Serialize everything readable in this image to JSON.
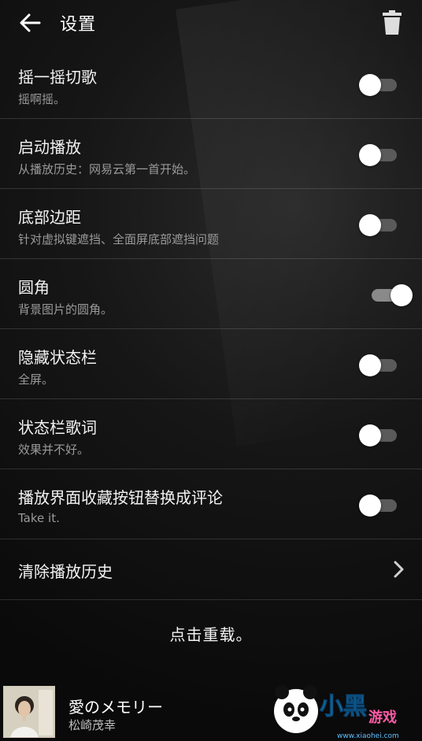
{
  "header": {
    "title": "设置",
    "back_icon": "arrow-left-icon",
    "delete_icon": "trash-icon"
  },
  "settings": [
    {
      "label": "摇一摇切歌",
      "desc": "摇啊摇。",
      "enabled": false
    },
    {
      "label": "启动播放",
      "desc": "从播放历史：网易云第一首开始。",
      "enabled": false
    },
    {
      "label": "底部边距",
      "desc": "针对虚拟键遮挡、全面屏底部遮挡问题",
      "enabled": false
    },
    {
      "label": "圆角",
      "desc": "背景图片的圆角。",
      "enabled": true
    },
    {
      "label": "隐藏状态栏",
      "desc": "全屏。",
      "enabled": false
    },
    {
      "label": "状态栏歌词",
      "desc": "效果并不好。",
      "enabled": false
    },
    {
      "label": "播放界面收藏按钮替换成评论",
      "desc": "Take it.",
      "enabled": false
    }
  ],
  "clear_history": {
    "label": "清除播放历史",
    "icon": "chevron-right-icon"
  },
  "reload_text": "点击重载。",
  "now_playing": {
    "title": "愛のメモリー",
    "artist": "松崎茂幸"
  },
  "watermark": {
    "text": "小黑游戏",
    "url": "www.xiaohei.com"
  },
  "colors": {
    "background": "#0b0b0b",
    "divider": "#2a2a2a",
    "subtext": "#9a9a9a",
    "switch_off_track": "#5a5a5a",
    "switch_thumb": "#ffffff"
  }
}
